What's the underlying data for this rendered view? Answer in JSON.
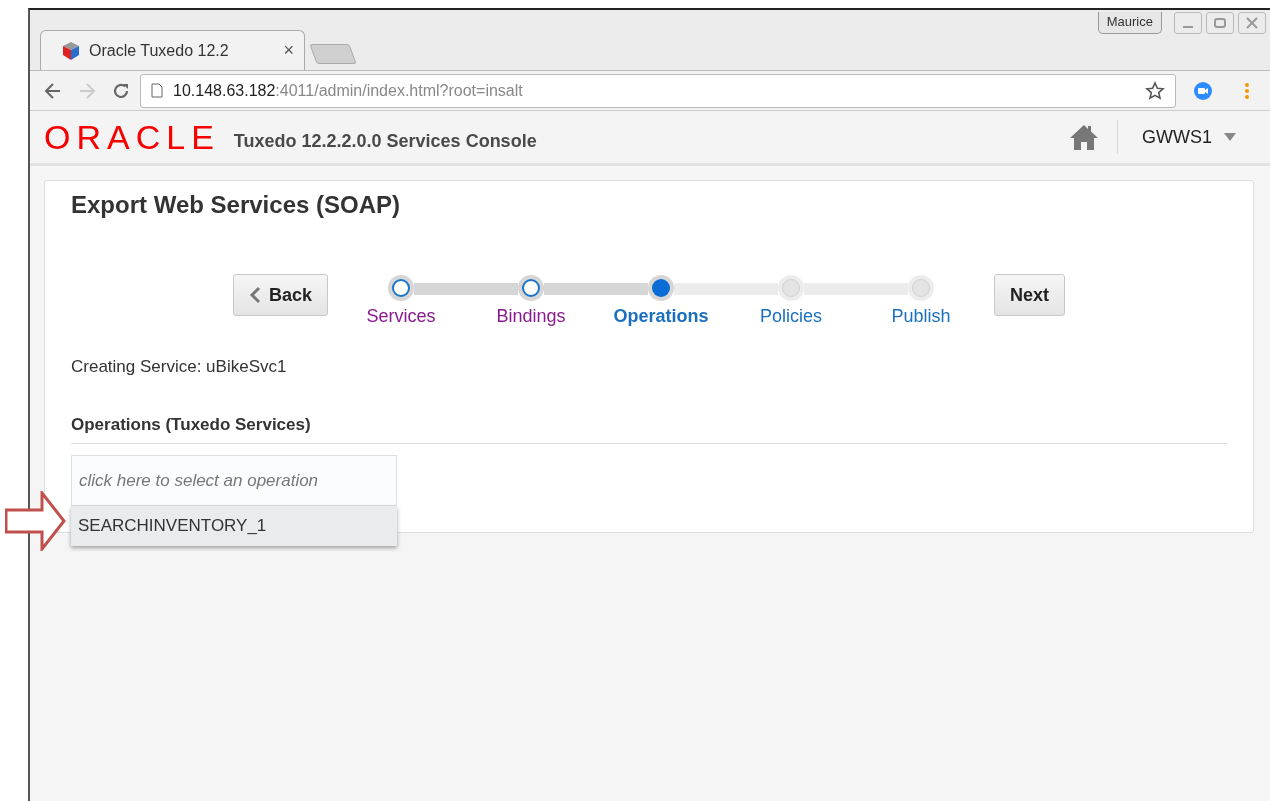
{
  "window": {
    "user": "Maurice"
  },
  "tab": {
    "title": "Oracle Tuxedo 12.2",
    "close": "×"
  },
  "address_bar": {
    "host": "10.148.63.182",
    "path": ":4011/admin/index.html?root=insalt"
  },
  "header": {
    "logo": "ORACLE",
    "title": "Tuxedo 12.2.2.0.0 Services Console",
    "domain": "GWWS1"
  },
  "page": {
    "title": "Export Web Services (SOAP)",
    "back": "Back",
    "next": "Next",
    "steps": [
      {
        "label": "Services",
        "visited": true,
        "selected": false
      },
      {
        "label": "Bindings",
        "visited": true,
        "selected": false
      },
      {
        "label": "Operations",
        "visited": true,
        "selected": true
      },
      {
        "label": "Policies",
        "visited": false,
        "selected": false
      },
      {
        "label": "Publish",
        "visited": false,
        "selected": false
      }
    ],
    "creating": "Creating Service: uBikeSvc1",
    "section": "Operations (Tuxedo Services)",
    "operation_field": {
      "placeholder": "click here to select an operation"
    },
    "options": [
      {
        "label": "SEARCHINVENTORY_1",
        "selected": true
      }
    ]
  }
}
